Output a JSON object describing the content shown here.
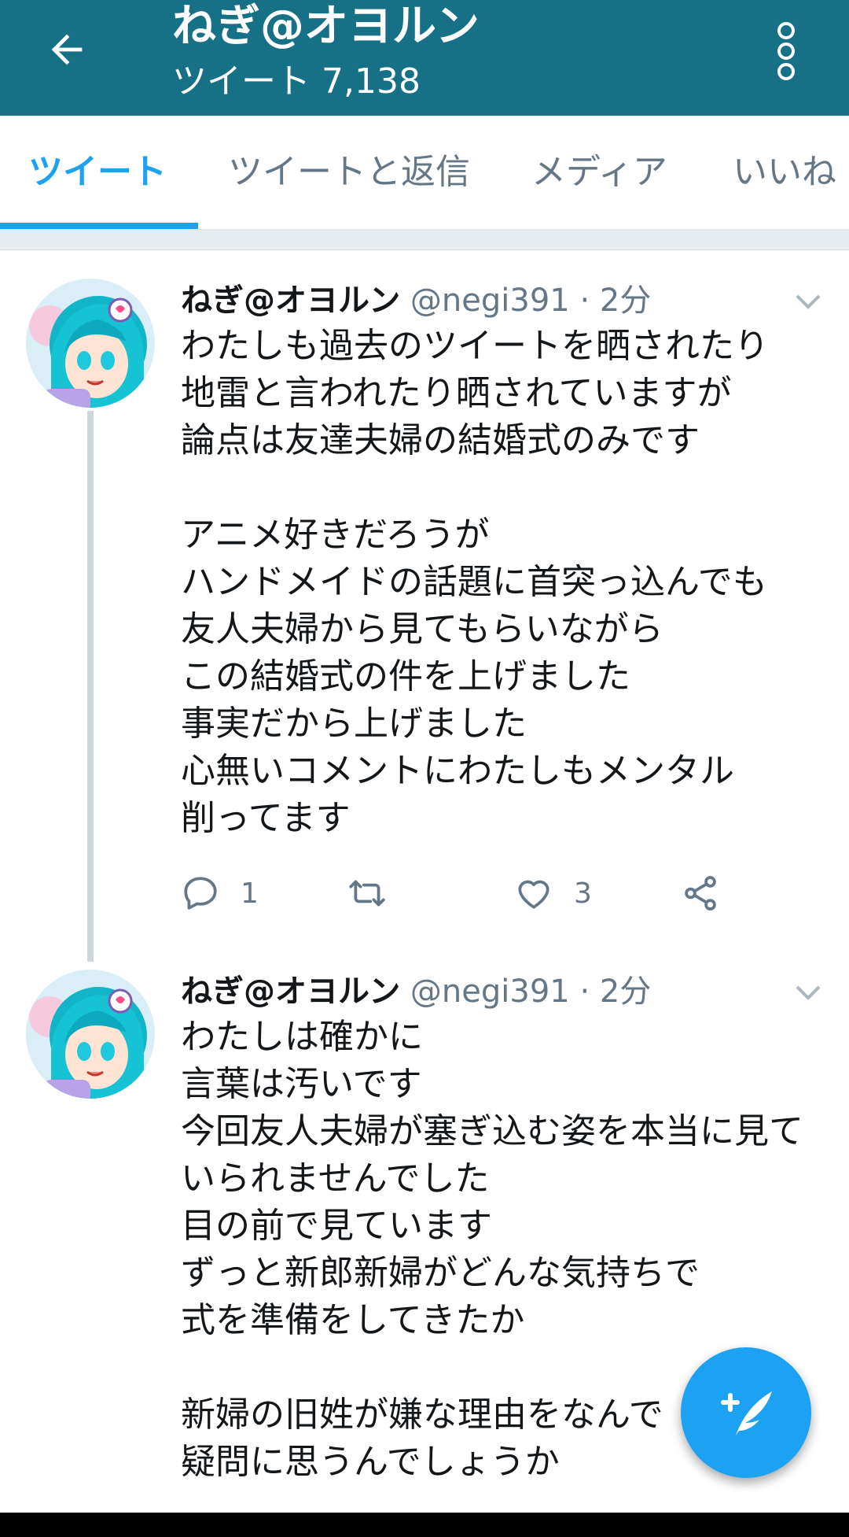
{
  "header": {
    "title": "ねぎ@オヨルン",
    "subtitle": "ツイート 7,138",
    "back_icon": "arrow-left-icon",
    "more_icon": "more-vertical-icon",
    "background_color": "#167086"
  },
  "tabs": [
    {
      "label": "ツイート",
      "active": true
    },
    {
      "label": "ツイートと返信",
      "active": false
    },
    {
      "label": "メディア",
      "active": false
    },
    {
      "label": "いいね",
      "active": false
    }
  ],
  "accent_color": "#1da1f2",
  "tweets": [
    {
      "name": "ねぎ@オヨルン",
      "handle": "@negi391",
      "separator": "·",
      "time": "2分",
      "lines": [
        "わたしも過去のツイートを晒されたり",
        "地雷と言われたり晒されていますが",
        "論点は友達夫婦の結婚式のみです",
        "",
        "アニメ好きだろうが",
        "ハンドメイドの話題に首突っ込んでも",
        "友人夫婦から見てもらいながら",
        "この結婚式の件を上げました",
        "事実だから上げました",
        "心無いコメントにわたしもメンタル",
        "削ってます"
      ],
      "actions": {
        "reply_count": "1",
        "retweet_count": "",
        "like_count": "3"
      }
    },
    {
      "name": "ねぎ@オヨルン",
      "handle": "@negi391",
      "separator": "·",
      "time": "2分",
      "lines": [
        "わたしは確かに",
        "言葉は汚いです",
        "今回友人夫婦が塞ぎ込む姿を本当に見て",
        "いられませんでした",
        "目の前で見ています",
        "ずっと新郎新婦がどんな気持ちで",
        "式を準備をしてきたか",
        "",
        "新婦の旧姓が嫌な理由をなんで",
        "疑問に思うんでしょうか"
      ]
    }
  ],
  "fab": {
    "icon": "compose-tweet-icon"
  }
}
